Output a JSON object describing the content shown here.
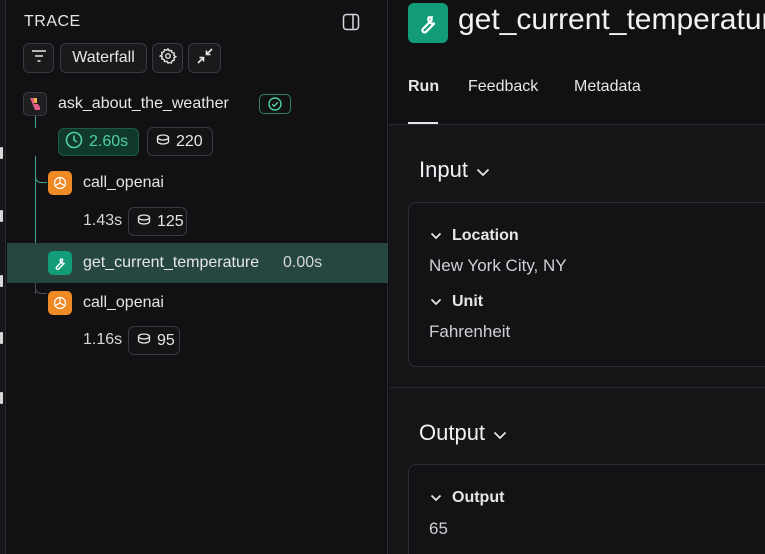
{
  "trace_panel": {
    "title": "TRACE",
    "view_mode": "Waterfall",
    "root": {
      "name": "ask_about_the_weather",
      "latency": "2.60s",
      "tokens": "220"
    },
    "children": [
      {
        "name": "call_openai",
        "latency": "1.43s",
        "tokens": "125",
        "icon": "openai-icon"
      },
      {
        "name": "get_current_temperature",
        "latency": "0.00s",
        "icon": "wrench-icon",
        "selected": true
      },
      {
        "name": "call_openai",
        "latency": "1.16s",
        "tokens": "95",
        "icon": "openai-icon"
      }
    ]
  },
  "detail": {
    "title": "get_current_temperature",
    "tabs": [
      "Run",
      "Feedback",
      "Metadata"
    ],
    "active_tab": "Run",
    "input": {
      "heading": "Input",
      "fields": [
        {
          "label": "Location",
          "value": "New York City, NY"
        },
        {
          "label": "Unit",
          "value": "Fahrenheit"
        }
      ]
    },
    "output": {
      "heading": "Output",
      "fields": [
        {
          "label": "Output",
          "value": "65"
        }
      ]
    }
  },
  "colors": {
    "accent_green": "#139c78",
    "selected_row": "#264640",
    "latency_chip_bg": "#11382d",
    "latency_chip_text": "#4fd1a5",
    "openai_orange": "#f08a24"
  }
}
